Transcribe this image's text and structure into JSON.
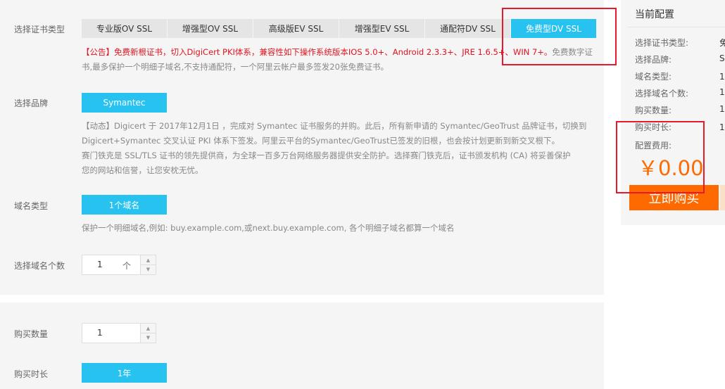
{
  "form": {
    "cert_type_label": "选择证书类型",
    "cert_types": [
      "专业版OV SSL",
      "增强型OV SSL",
      "高级版EV SSL",
      "增强型EV SSL",
      "通配符DV SSL",
      "免费型DV SSL"
    ],
    "notice_red": "【公告】免费新根证书，切入DigiCert PKI体系，兼容性如下操作系统版本IOS 5.0+、Android 2.3.3+、JRE 1.6.5+、WIN 7+。",
    "notice_gray_1": "免费数字证",
    "notice_gray_2": "书,最多保护一个明细子域名,不支持通配符，一个阿里云帐户最多签发20张免费证书。",
    "brand_label": "选择品牌",
    "brand_value": "Symantec",
    "brand_desc": [
      "【动态】Digicert 于 2017年12月1日 ，完成对 Symantec 证书服务的并购。此后，所有新申请的 Symantec/GeoTrust 品牌证书，切换到",
      "Digicert+Symantec 交叉认证 PKI 体系下签发。阿里云平台的Symantec/GeoTrust已签发的旧根，也会按计划更新到新交叉根下。",
      "赛门铁克是 SSL/TLS 证书的领先提供商，为全球一百多万台网络服务器提供安全防护。选择赛门铁克后，证书颁发机构 (CA) 将妥善保护",
      "您的网站和信誉，让您安枕无忧。"
    ],
    "domain_type_label": "域名类型",
    "domain_type_value": "1个域名",
    "domain_type_desc": "保护一个明细域名,例如: buy.example.com,或next.buy.example.com, 各个明细子域名都算一个域名",
    "domain_count_label": "选择域名个数",
    "domain_count_value": "1",
    "domain_count_unit": "个",
    "quantity_label": "购买数量",
    "quantity_value": "1",
    "duration_label": "购买时长",
    "duration_value": "1年"
  },
  "sidebar": {
    "title": "当前配置",
    "rows": [
      {
        "label": "选择证书类型:",
        "value": "免"
      },
      {
        "label": "选择品牌:",
        "value": "Sy"
      },
      {
        "label": "域名类型:",
        "value": "1个"
      },
      {
        "label": "选择域名个数:",
        "value": "1"
      },
      {
        "label": "购买数量:",
        "value": "1"
      },
      {
        "label": "购买时长:",
        "value": "1年"
      },
      {
        "label": "配置费用:",
        "value": ""
      }
    ],
    "price": "￥0.00",
    "buy_label": "立即购买"
  },
  "colors": {
    "accent": "#27c2f0",
    "buy": "#ff6a00",
    "notice_red": "#e0141e",
    "annotation_box": "#e8192c"
  }
}
